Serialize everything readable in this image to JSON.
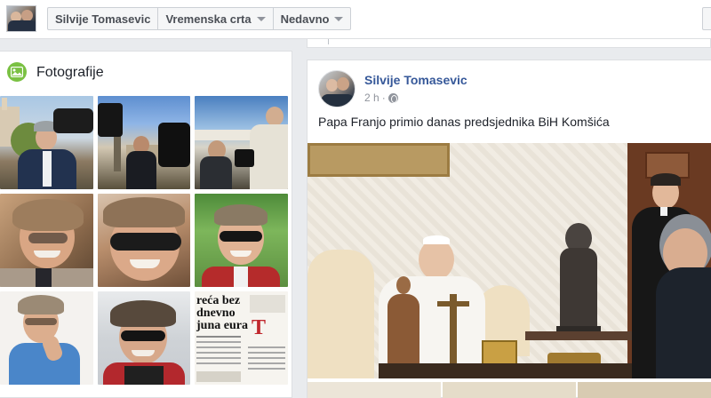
{
  "timeline_nav": {
    "crumbs": [
      {
        "label": "Silvije Tomasevic",
        "has_caret": false
      },
      {
        "label": "Vremenska crta",
        "has_caret": true
      },
      {
        "label": "Nedavno",
        "has_caret": true
      }
    ]
  },
  "photos": {
    "title": "Fotografije",
    "icon": "photos-icon",
    "thumb_text": {
      "headline_lines": [
        "reća bez",
        "dnevno",
        "juna eura"
      ],
      "letter": "T"
    }
  },
  "post": {
    "author": "Silvije Tomasevic",
    "time": "2 h",
    "privacy_icon": "globe-icon",
    "text": "Papa Franjo primio danas predsjednika BiH Komšića"
  },
  "colors": {
    "link_blue": "#365899",
    "page_bg": "#e9ebee",
    "photos_green": "#7ac143"
  }
}
